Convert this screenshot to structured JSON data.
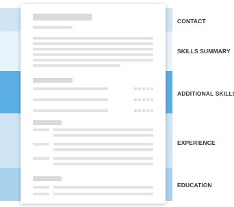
{
  "colors": {
    "band_light": "#e8f2fa",
    "band_mid": "#cfe5f4",
    "band_dark": "#a8d2ee",
    "accent": "#5aaee3"
  },
  "sections": [
    {
      "label": "CONTACT"
    },
    {
      "label": "SKILLS SUMMARY"
    },
    {
      "label": "ADDITIONAL SKILLS"
    },
    {
      "label": "EXPERIENCE"
    },
    {
      "label": "EDUCATION"
    }
  ]
}
